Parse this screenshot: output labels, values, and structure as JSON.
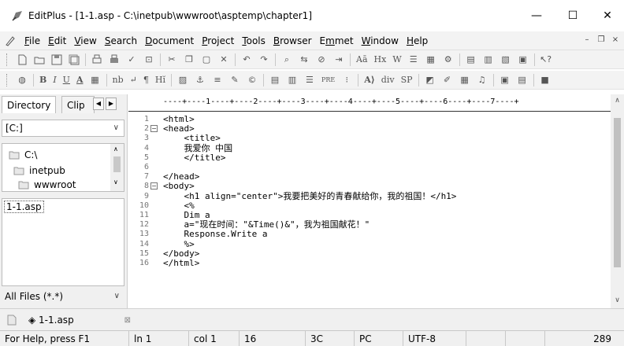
{
  "window": {
    "title": "EditPlus - [1-1.asp - C:\\inetpub\\wwwroot\\asptemp\\chapter1]",
    "minimize": "—",
    "maximize": "☐",
    "close": "✕"
  },
  "menu": {
    "items": [
      {
        "key": "F",
        "rest": "ile"
      },
      {
        "key": "E",
        "rest": "dit"
      },
      {
        "key": "V",
        "rest": "iew"
      },
      {
        "key": "S",
        "rest": "earch"
      },
      {
        "key": "D",
        "rest": "ocument"
      },
      {
        "key": "P",
        "rest": "roject"
      },
      {
        "key": "T",
        "rest": "ools"
      },
      {
        "key": "B",
        "rest": "rowser"
      },
      {
        "pre": "E",
        "key": "m",
        "rest": "met"
      },
      {
        "key": "W",
        "rest": "indow"
      },
      {
        "key": "H",
        "rest": "elp"
      }
    ],
    "mdi_min": "–",
    "mdi_restore": "❐",
    "mdi_close": "×"
  },
  "toolbar2": {
    "bold": "B",
    "italic": "I",
    "underline": "U",
    "font_a": "A",
    "nb": "nb",
    "enter": "↵",
    "para": "¶",
    "hi": "Hĭ",
    "pre": "PRE",
    "div": "div",
    "sp": "SP",
    "atag": "A⟩"
  },
  "toolbar1": {
    "ab": "Aā",
    "hx": "Hx",
    "w": "W"
  },
  "sidebar": {
    "tab_directory": "Directory",
    "tab_clip": "Clip",
    "drive": "[C:]",
    "dirs": [
      "C:\\",
      "inetpub",
      "wwwroot"
    ],
    "file": "1-1.asp",
    "filter": "All Files (*.*)"
  },
  "ruler": "----+----1----+----2----+----3----+----4----+----5----+----6----+----7----+",
  "code": {
    "lines": [
      {
        "n": "1",
        "text": "<html>",
        "fold": ""
      },
      {
        "n": "2",
        "text": "<head>",
        "fold": "⊟"
      },
      {
        "n": "3",
        "text": "    <title>",
        "fold": ""
      },
      {
        "n": "4",
        "text": "    我爱你 中国",
        "fold": ""
      },
      {
        "n": "5",
        "text": "    </title>",
        "fold": ""
      },
      {
        "n": "6",
        "text": "",
        "fold": ""
      },
      {
        "n": "7",
        "text": "</head>",
        "fold": ""
      },
      {
        "n": "8",
        "text": "<body>",
        "fold": "⊟"
      },
      {
        "n": "9",
        "text": "    <h1 align=\"center\">我要把美好的青春献给你，我的祖国！</h1>",
        "fold": ""
      },
      {
        "n": "10",
        "text": "    <%",
        "fold": ""
      },
      {
        "n": "11",
        "text": "    Dim a",
        "fold": ""
      },
      {
        "n": "12",
        "text": "    a=\"现在时间：\"&Time()&\"，我为祖国献花！\"",
        "fold": ""
      },
      {
        "n": "13",
        "text": "    Response.Write a",
        "fold": ""
      },
      {
        "n": "14",
        "text": "    %>",
        "fold": ""
      },
      {
        "n": "15",
        "text": "</body>",
        "fold": ""
      },
      {
        "n": "16",
        "text": "</html>",
        "fold": ""
      }
    ]
  },
  "doctab": {
    "label": "◈ 1-1.asp",
    "close": "⊠"
  },
  "status": {
    "help": "For Help, press F1",
    "line": "ln 1",
    "col": "col 1",
    "num1": "16",
    "num2": "3C",
    "mode": "PC",
    "encoding": "UTF-8",
    "size": "289"
  }
}
